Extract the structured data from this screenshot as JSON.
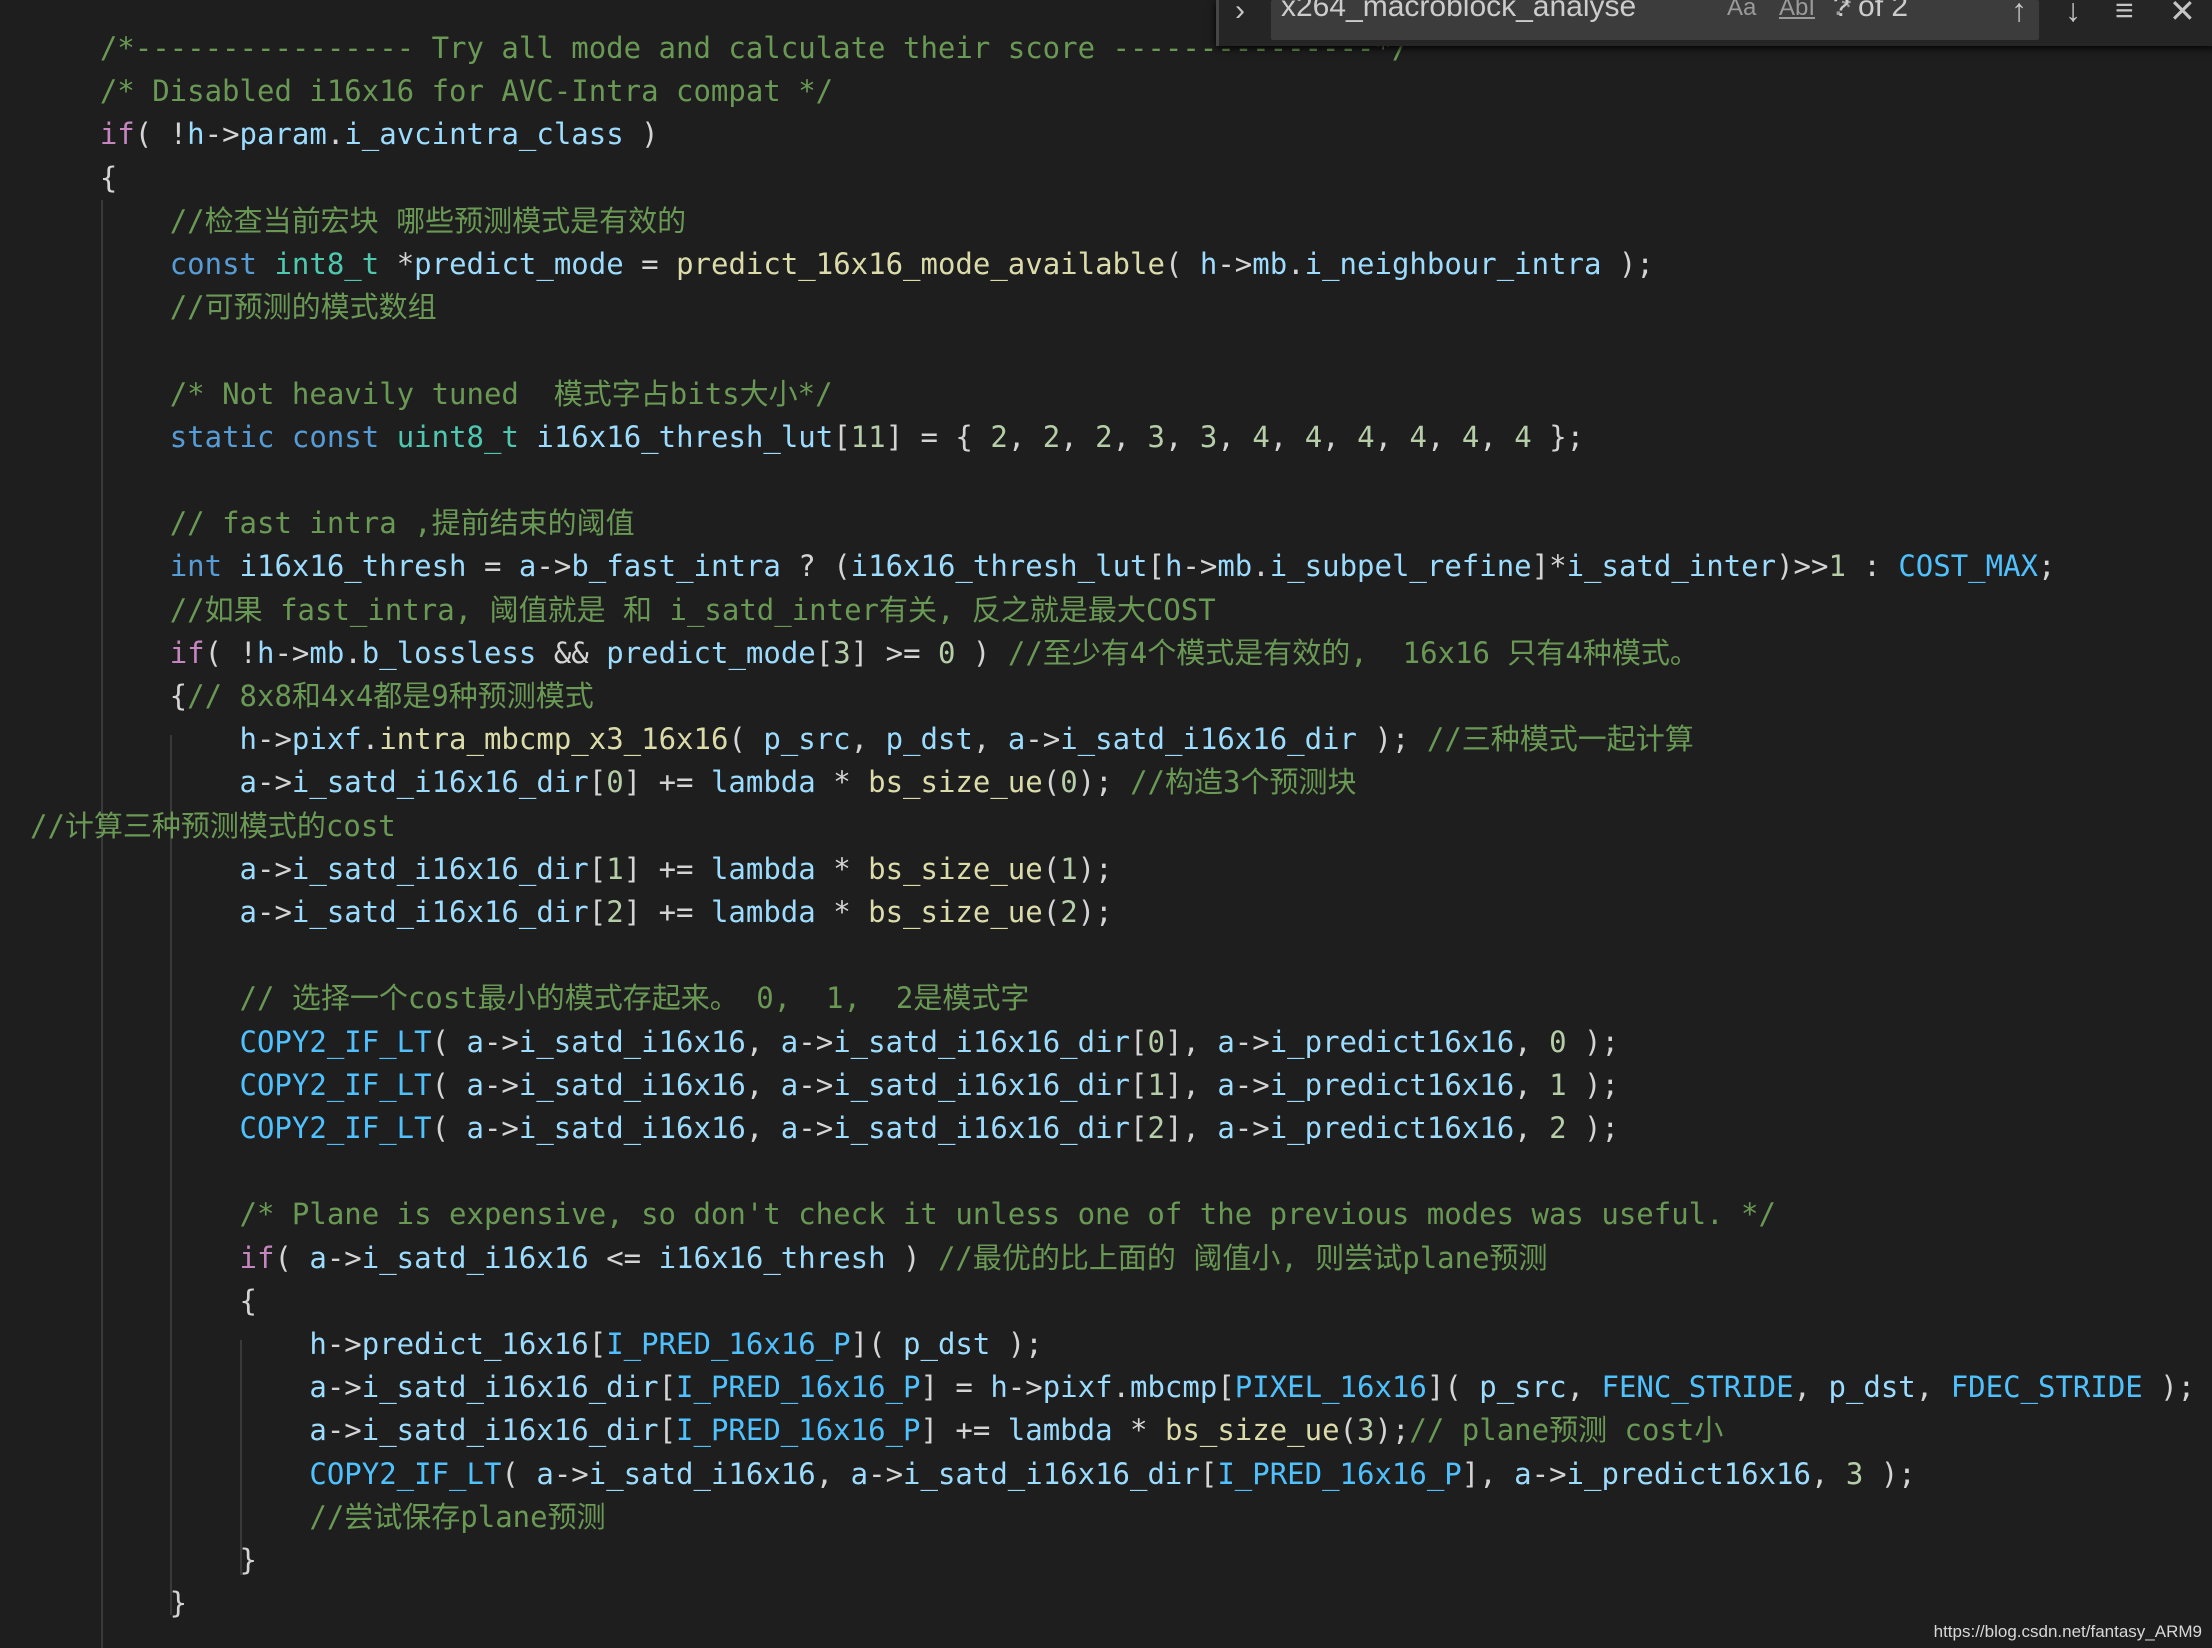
{
  "find": {
    "query": "x264_macroblock_analyse",
    "match_case_label": "Aa",
    "whole_word_label": "AbI",
    "regex_label": ".*",
    "count": "? of 2",
    "toggle_icon": "chevron-right-icon",
    "prev_icon": "arrow-up-icon",
    "next_icon": "arrow-down-icon",
    "selection_icon": "lines-icon",
    "close_icon": "close-icon"
  },
  "watermark": "https://blog.csdn.net/fantasy_ARM9",
  "code": [
    [
      [
        "    ",
        "p"
      ],
      [
        "/*---------------- Try all mode and calculate their score ---------------*/",
        "c"
      ]
    ],
    [
      [
        "    ",
        "p"
      ],
      [
        "/* Disabled i16x16 for AVC-Intra compat */",
        "c"
      ]
    ],
    [
      [
        "    ",
        "p"
      ],
      [
        "if",
        "k"
      ],
      [
        "( !",
        "p"
      ],
      [
        "h",
        "v"
      ],
      [
        "->",
        "p"
      ],
      [
        "param",
        "v"
      ],
      [
        ".",
        "p"
      ],
      [
        "i_avcintra_class",
        "v"
      ],
      [
        " )",
        "p"
      ]
    ],
    [
      [
        "    {",
        "p"
      ]
    ],
    [
      [
        "        ",
        "p"
      ],
      [
        "//检查当前宏块 哪些预测模式是有效的",
        "c"
      ]
    ],
    [
      [
        "        ",
        "p"
      ],
      [
        "const",
        "t"
      ],
      [
        " ",
        "p"
      ],
      [
        "int8_t",
        "ty"
      ],
      [
        " *",
        "p"
      ],
      [
        "predict_mode",
        "v"
      ],
      [
        " = ",
        "p"
      ],
      [
        "predict_16x16_mode_available",
        "f"
      ],
      [
        "( ",
        "p"
      ],
      [
        "h",
        "v"
      ],
      [
        "->",
        "p"
      ],
      [
        "mb",
        "v"
      ],
      [
        ".",
        "p"
      ],
      [
        "i_neighbour_intra",
        "v"
      ],
      [
        " );",
        "p"
      ]
    ],
    [
      [
        "        ",
        "p"
      ],
      [
        "//可预测的模式数组",
        "c"
      ]
    ],
    [],
    [
      [
        "        ",
        "p"
      ],
      [
        "/* Not heavily tuned  模式字占bits大小*/",
        "c"
      ]
    ],
    [
      [
        "        ",
        "p"
      ],
      [
        "static",
        "t"
      ],
      [
        " ",
        "p"
      ],
      [
        "const",
        "t"
      ],
      [
        " ",
        "p"
      ],
      [
        "uint8_t",
        "ty"
      ],
      [
        " ",
        "p"
      ],
      [
        "i16x16_thresh_lut",
        "v"
      ],
      [
        "[",
        "p"
      ],
      [
        "11",
        "n"
      ],
      [
        "] = { ",
        "p"
      ],
      [
        "2",
        "n"
      ],
      [
        ", ",
        "p"
      ],
      [
        "2",
        "n"
      ],
      [
        ", ",
        "p"
      ],
      [
        "2",
        "n"
      ],
      [
        ", ",
        "p"
      ],
      [
        "3",
        "n"
      ],
      [
        ", ",
        "p"
      ],
      [
        "3",
        "n"
      ],
      [
        ", ",
        "p"
      ],
      [
        "4",
        "n"
      ],
      [
        ", ",
        "p"
      ],
      [
        "4",
        "n"
      ],
      [
        ", ",
        "p"
      ],
      [
        "4",
        "n"
      ],
      [
        ", ",
        "p"
      ],
      [
        "4",
        "n"
      ],
      [
        ", ",
        "p"
      ],
      [
        "4",
        "n"
      ],
      [
        ", ",
        "p"
      ],
      [
        "4",
        "n"
      ],
      [
        " };",
        "p"
      ]
    ],
    [],
    [
      [
        "        ",
        "p"
      ],
      [
        "// fast intra ,提前结束的阈值",
        "c"
      ]
    ],
    [
      [
        "        ",
        "p"
      ],
      [
        "int",
        "t"
      ],
      [
        " ",
        "p"
      ],
      [
        "i16x16_thresh",
        "v"
      ],
      [
        " = ",
        "p"
      ],
      [
        "a",
        "v"
      ],
      [
        "->",
        "p"
      ],
      [
        "b_fast_intra",
        "v"
      ],
      [
        " ? (",
        "p"
      ],
      [
        "i16x16_thresh_lut",
        "v"
      ],
      [
        "[",
        "p"
      ],
      [
        "h",
        "v"
      ],
      [
        "->",
        "p"
      ],
      [
        "mb",
        "v"
      ],
      [
        ".",
        "p"
      ],
      [
        "i_subpel_refine",
        "v"
      ],
      [
        "]*",
        "p"
      ],
      [
        "i_satd_inter",
        "v"
      ],
      [
        ")>>",
        "p"
      ],
      [
        "1",
        "n"
      ],
      [
        " : ",
        "p"
      ],
      [
        "COST_MAX",
        "m"
      ],
      [
        ";",
        "p"
      ]
    ],
    [
      [
        "        ",
        "p"
      ],
      [
        "//如果 fast_intra, 阈值就是 和 i_satd_inter有关, 反之就是最大COST",
        "c"
      ]
    ],
    [
      [
        "        ",
        "p"
      ],
      [
        "if",
        "k"
      ],
      [
        "( !",
        "p"
      ],
      [
        "h",
        "v"
      ],
      [
        "->",
        "p"
      ],
      [
        "mb",
        "v"
      ],
      [
        ".",
        "p"
      ],
      [
        "b_lossless",
        "v"
      ],
      [
        " && ",
        "p"
      ],
      [
        "predict_mode",
        "v"
      ],
      [
        "[",
        "p"
      ],
      [
        "3",
        "n"
      ],
      [
        "] >= ",
        "p"
      ],
      [
        "0",
        "n"
      ],
      [
        " ) ",
        "p"
      ],
      [
        "//至少有4个模式是有效的,  16x16 只有4种模式。",
        "c"
      ]
    ],
    [
      [
        "        {",
        "p"
      ],
      [
        "// 8x8和4x4都是9种预测模式",
        "c"
      ]
    ],
    [
      [
        "            ",
        "p"
      ],
      [
        "h",
        "v"
      ],
      [
        "->",
        "p"
      ],
      [
        "pixf",
        "v"
      ],
      [
        ".",
        "p"
      ],
      [
        "intra_mbcmp_x3_16x16",
        "f"
      ],
      [
        "( ",
        "p"
      ],
      [
        "p_src",
        "v"
      ],
      [
        ", ",
        "p"
      ],
      [
        "p_dst",
        "v"
      ],
      [
        ", ",
        "p"
      ],
      [
        "a",
        "v"
      ],
      [
        "->",
        "p"
      ],
      [
        "i_satd_i16x16_dir",
        "v"
      ],
      [
        " ); ",
        "p"
      ],
      [
        "//三种模式一起计算",
        "c"
      ]
    ],
    [
      [
        "            ",
        "p"
      ],
      [
        "a",
        "v"
      ],
      [
        "->",
        "p"
      ],
      [
        "i_satd_i16x16_dir",
        "v"
      ],
      [
        "[",
        "p"
      ],
      [
        "0",
        "n"
      ],
      [
        "] += ",
        "p"
      ],
      [
        "lambda",
        "v"
      ],
      [
        " * ",
        "p"
      ],
      [
        "bs_size_ue",
        "f"
      ],
      [
        "(",
        "p"
      ],
      [
        "0",
        "n"
      ],
      [
        "); ",
        "p"
      ],
      [
        "//构造3个预测块",
        "c"
      ]
    ],
    [
      [
        "//计算三种预测模式的cost",
        "c"
      ]
    ],
    [
      [
        "            ",
        "p"
      ],
      [
        "a",
        "v"
      ],
      [
        "->",
        "p"
      ],
      [
        "i_satd_i16x16_dir",
        "v"
      ],
      [
        "[",
        "p"
      ],
      [
        "1",
        "n"
      ],
      [
        "] += ",
        "p"
      ],
      [
        "lambda",
        "v"
      ],
      [
        " * ",
        "p"
      ],
      [
        "bs_size_ue",
        "f"
      ],
      [
        "(",
        "p"
      ],
      [
        "1",
        "n"
      ],
      [
        ");",
        "p"
      ]
    ],
    [
      [
        "            ",
        "p"
      ],
      [
        "a",
        "v"
      ],
      [
        "->",
        "p"
      ],
      [
        "i_satd_i16x16_dir",
        "v"
      ],
      [
        "[",
        "p"
      ],
      [
        "2",
        "n"
      ],
      [
        "] += ",
        "p"
      ],
      [
        "lambda",
        "v"
      ],
      [
        " * ",
        "p"
      ],
      [
        "bs_size_ue",
        "f"
      ],
      [
        "(",
        "p"
      ],
      [
        "2",
        "n"
      ],
      [
        ");",
        "p"
      ]
    ],
    [],
    [
      [
        "            ",
        "p"
      ],
      [
        "// 选择一个cost最小的模式存起来。 0,  1,  2是模式字",
        "c"
      ]
    ],
    [
      [
        "            ",
        "p"
      ],
      [
        "COPY2_IF_LT",
        "m"
      ],
      [
        "( ",
        "p"
      ],
      [
        "a",
        "v"
      ],
      [
        "->",
        "p"
      ],
      [
        "i_satd_i16x16",
        "v"
      ],
      [
        ", ",
        "p"
      ],
      [
        "a",
        "v"
      ],
      [
        "->",
        "p"
      ],
      [
        "i_satd_i16x16_dir",
        "v"
      ],
      [
        "[",
        "p"
      ],
      [
        "0",
        "n"
      ],
      [
        "], ",
        "p"
      ],
      [
        "a",
        "v"
      ],
      [
        "->",
        "p"
      ],
      [
        "i_predict16x16",
        "v"
      ],
      [
        ", ",
        "p"
      ],
      [
        "0",
        "n"
      ],
      [
        " );",
        "p"
      ]
    ],
    [
      [
        "            ",
        "p"
      ],
      [
        "COPY2_IF_LT",
        "m"
      ],
      [
        "( ",
        "p"
      ],
      [
        "a",
        "v"
      ],
      [
        "->",
        "p"
      ],
      [
        "i_satd_i16x16",
        "v"
      ],
      [
        ", ",
        "p"
      ],
      [
        "a",
        "v"
      ],
      [
        "->",
        "p"
      ],
      [
        "i_satd_i16x16_dir",
        "v"
      ],
      [
        "[",
        "p"
      ],
      [
        "1",
        "n"
      ],
      [
        "], ",
        "p"
      ],
      [
        "a",
        "v"
      ],
      [
        "->",
        "p"
      ],
      [
        "i_predict16x16",
        "v"
      ],
      [
        ", ",
        "p"
      ],
      [
        "1",
        "n"
      ],
      [
        " );",
        "p"
      ]
    ],
    [
      [
        "            ",
        "p"
      ],
      [
        "COPY2_IF_LT",
        "m"
      ],
      [
        "( ",
        "p"
      ],
      [
        "a",
        "v"
      ],
      [
        "->",
        "p"
      ],
      [
        "i_satd_i16x16",
        "v"
      ],
      [
        ", ",
        "p"
      ],
      [
        "a",
        "v"
      ],
      [
        "->",
        "p"
      ],
      [
        "i_satd_i16x16_dir",
        "v"
      ],
      [
        "[",
        "p"
      ],
      [
        "2",
        "n"
      ],
      [
        "], ",
        "p"
      ],
      [
        "a",
        "v"
      ],
      [
        "->",
        "p"
      ],
      [
        "i_predict16x16",
        "v"
      ],
      [
        ", ",
        "p"
      ],
      [
        "2",
        "n"
      ],
      [
        " );",
        "p"
      ]
    ],
    [],
    [
      [
        "            ",
        "p"
      ],
      [
        "/* Plane is expensive, so don't check it unless one of the previous modes was useful. */",
        "c"
      ]
    ],
    [
      [
        "            ",
        "p"
      ],
      [
        "if",
        "k"
      ],
      [
        "( ",
        "p"
      ],
      [
        "a",
        "v"
      ],
      [
        "->",
        "p"
      ],
      [
        "i_satd_i16x16",
        "v"
      ],
      [
        " <= ",
        "p"
      ],
      [
        "i16x16_thresh",
        "v"
      ],
      [
        " ) ",
        "p"
      ],
      [
        "//最优的比上面的 阈值小, 则尝试plane预测",
        "c"
      ]
    ],
    [
      [
        "            {",
        "p"
      ]
    ],
    [
      [
        "                ",
        "p"
      ],
      [
        "h",
        "v"
      ],
      [
        "->",
        "p"
      ],
      [
        "predict_16x16",
        "v"
      ],
      [
        "[",
        "p"
      ],
      [
        "I_PRED_16x16_P",
        "m"
      ],
      [
        "]( ",
        "p"
      ],
      [
        "p_dst",
        "v"
      ],
      [
        " );",
        "p"
      ]
    ],
    [
      [
        "                ",
        "p"
      ],
      [
        "a",
        "v"
      ],
      [
        "->",
        "p"
      ],
      [
        "i_satd_i16x16_dir",
        "v"
      ],
      [
        "[",
        "p"
      ],
      [
        "I_PRED_16x16_P",
        "m"
      ],
      [
        "] = ",
        "p"
      ],
      [
        "h",
        "v"
      ],
      [
        "->",
        "p"
      ],
      [
        "pixf",
        "v"
      ],
      [
        ".",
        "p"
      ],
      [
        "mbcmp",
        "v"
      ],
      [
        "[",
        "p"
      ],
      [
        "PIXEL_16x16",
        "m"
      ],
      [
        "]( ",
        "p"
      ],
      [
        "p_src",
        "v"
      ],
      [
        ", ",
        "p"
      ],
      [
        "FENC_STRIDE",
        "m"
      ],
      [
        ", ",
        "p"
      ],
      [
        "p_dst",
        "v"
      ],
      [
        ", ",
        "p"
      ],
      [
        "FDEC_STRIDE",
        "m"
      ],
      [
        " );",
        "p"
      ]
    ],
    [
      [
        "                ",
        "p"
      ],
      [
        "a",
        "v"
      ],
      [
        "->",
        "p"
      ],
      [
        "i_satd_i16x16_dir",
        "v"
      ],
      [
        "[",
        "p"
      ],
      [
        "I_PRED_16x16_P",
        "m"
      ],
      [
        "] += ",
        "p"
      ],
      [
        "lambda",
        "v"
      ],
      [
        " * ",
        "p"
      ],
      [
        "bs_size_ue",
        "f"
      ],
      [
        "(",
        "p"
      ],
      [
        "3",
        "n"
      ],
      [
        ");",
        "p"
      ],
      [
        "// plane预测 cost小",
        "c"
      ]
    ],
    [
      [
        "                ",
        "p"
      ],
      [
        "COPY2_IF_LT",
        "m"
      ],
      [
        "( ",
        "p"
      ],
      [
        "a",
        "v"
      ],
      [
        "->",
        "p"
      ],
      [
        "i_satd_i16x16",
        "v"
      ],
      [
        ", ",
        "p"
      ],
      [
        "a",
        "v"
      ],
      [
        "->",
        "p"
      ],
      [
        "i_satd_i16x16_dir",
        "v"
      ],
      [
        "[",
        "p"
      ],
      [
        "I_PRED_16x16_P",
        "m"
      ],
      [
        "], ",
        "p"
      ],
      [
        "a",
        "v"
      ],
      [
        "->",
        "p"
      ],
      [
        "i_predict16x16",
        "v"
      ],
      [
        ", ",
        "p"
      ],
      [
        "3",
        "n"
      ],
      [
        " );",
        "p"
      ]
    ],
    [
      [
        "                ",
        "p"
      ],
      [
        "//尝试保存plane预测",
        "c"
      ]
    ],
    [
      [
        "            }",
        "p"
      ]
    ],
    [
      [
        "        }",
        "p"
      ]
    ]
  ]
}
